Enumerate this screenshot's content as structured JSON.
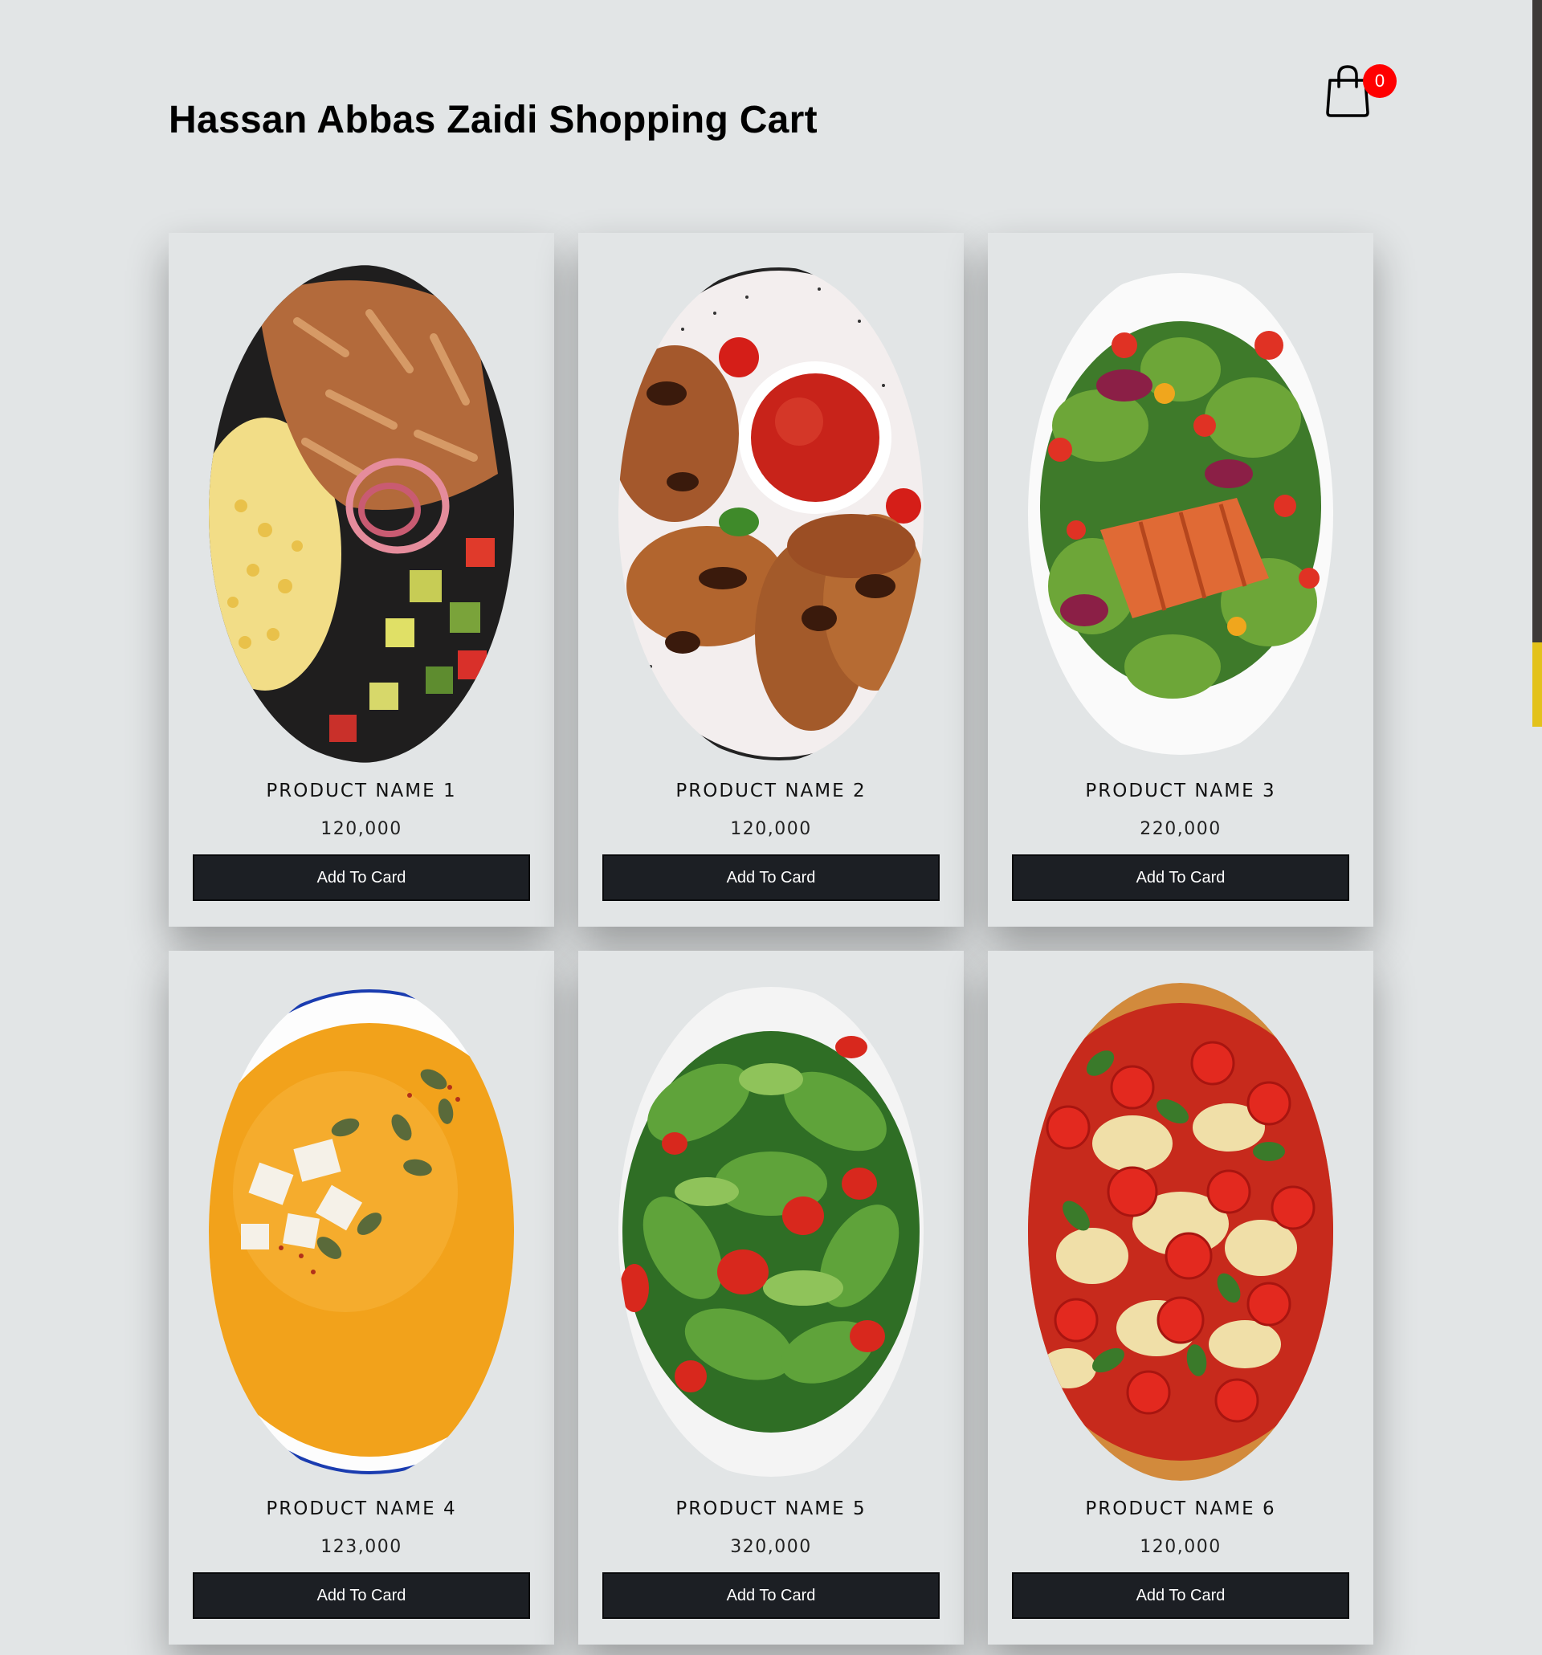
{
  "header": {
    "title": "Hassan Abbas Zaidi Shopping Cart",
    "cart_icon": "shopping-bag-icon",
    "cart_count": "0"
  },
  "colors": {
    "background": "#e2e5e6",
    "button": "#1c1f24",
    "badge": "#ff0000",
    "scroll_thumb": "#e3c21b"
  },
  "products": [
    {
      "name": "PRODUCT NAME 1",
      "price": "120,000",
      "button_label": "Add To Card",
      "image": "grilled-chicken-corn-bowl"
    },
    {
      "name": "PRODUCT NAME 2",
      "price": "120,000",
      "button_label": "Add To Card",
      "image": "chicken-wings-with-dip"
    },
    {
      "name": "PRODUCT NAME 3",
      "price": "220,000",
      "button_label": "Add To Card",
      "image": "salmon-salad"
    },
    {
      "name": "PRODUCT NAME 4",
      "price": "123,000",
      "button_label": "Add To Card",
      "image": "pumpkin-soup"
    },
    {
      "name": "PRODUCT NAME 5",
      "price": "320,000",
      "button_label": "Add To Card",
      "image": "green-salad-tomatoes"
    },
    {
      "name": "PRODUCT NAME 6",
      "price": "120,000",
      "button_label": "Add To Card",
      "image": "margherita-pizza"
    }
  ]
}
